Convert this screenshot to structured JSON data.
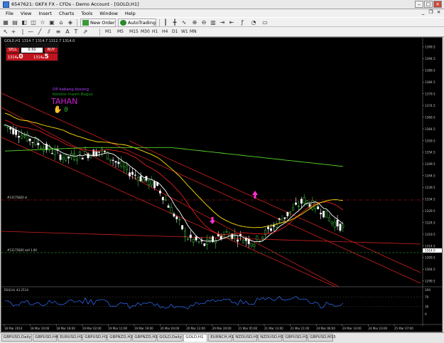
{
  "window": {
    "title": "6547621: GKFX FX - CFDs - Demo Account - [GOLD,H1]"
  },
  "menu": [
    "File",
    "View",
    "Insert",
    "Charts",
    "Tools",
    "Window",
    "Help"
  ],
  "toolbar": {
    "new_order": "New Order",
    "autotrading": "AutoTrading",
    "timeframes": [
      "M1",
      "M5",
      "M15",
      "M30",
      "H1",
      "H4",
      "D1",
      "W1",
      "MN"
    ]
  },
  "chart": {
    "symbol_label": "GOLD,H1  1314.7 1314.7 1312.7 1314.0",
    "trade_panel": {
      "sell": "SELL",
      "buy": "BUY",
      "lot": "0.50",
      "bid_prefix": "1314",
      "bid_big": ".0",
      "ask_prefix": "1314",
      "ask_big": ".5"
    },
    "annotations": {
      "line1": "OP kabang kosong",
      "line2": "Kondisi masih Bagus",
      "line3": "TAHAN"
    },
    "hlines": {
      "upper": "#13175820 sl",
      "lower": "#13175820 sell 1.00"
    },
    "price_marker": "1314.0",
    "price_axis": [
      "1399.5",
      "1394.5",
      "1389.5",
      "1384.5",
      "1379.5",
      "1374.5",
      "1369.5",
      "1364.5",
      "1359.5",
      "1354.5",
      "1349.5",
      "1344.5",
      "1339.5",
      "1334.5",
      "1329.5",
      "1324.5",
      "1319.5",
      "1314.5",
      "1309.5",
      "1304.5",
      "1299.5"
    ],
    "rsi_label": "RSI(14) 43.2514",
    "rsi_axis": [
      "100",
      "70",
      "30",
      "0"
    ],
    "time_axis": [
      "18 Mar 2014",
      "18 Mar 10:00",
      "18 Mar 18:00",
      "19 Mar 02:00",
      "19 Mar 11:00",
      "19 Mar 19:00",
      "20 Mar 04:00",
      "20 Mar 12:00",
      "20 Mar 20:00",
      "21 Mar 05:00",
      "21 Mar 13:00",
      "21 Mar 21:00",
      "24 Mar 06:00",
      "24 Mar 14:00",
      "24 Mar 23:00",
      "25 Mar 07:00"
    ],
    "colors": {
      "bull": "#3ec83e",
      "bear": "#ffffff",
      "ma_white": "#ffffff",
      "ma_yellow": "#ffe000",
      "ma_red": "#e02020",
      "ma_green": "#58d828",
      "channel": "#d02020",
      "arrow": "#ff30d0",
      "rsi": "#3070ff"
    }
  },
  "tabs": [
    "GBPUSD,Daily",
    "GBPUSD,H4",
    "EURUSD,H1",
    "GBPUSD,H1",
    "GBPNZD,H1",
    "GBPNZD,H1",
    "GOLD,Daily",
    "GOLD,H1",
    "EURNCH,H1",
    "NZDUSD,H1",
    "NZDUSD,H1",
    "GBPUSD,H1",
    "GBPUSD,M15"
  ],
  "active_tab": "GOLD,H1"
}
